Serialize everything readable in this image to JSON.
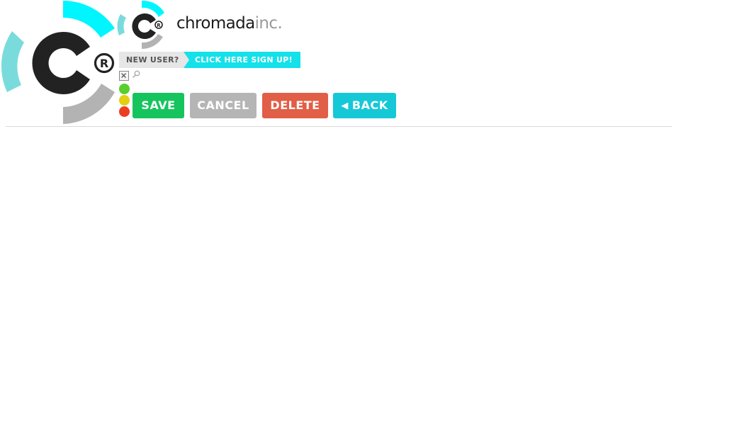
{
  "brand": {
    "logo_letter": "C",
    "registered_mark": "®",
    "wordmark_primary": "chromada",
    "wordmark_secondary": "inc.",
    "colors": {
      "cyan": "#00f6ff",
      "teal_light": "#7adbdd",
      "gray": "#b3b3b3",
      "dark": "#222222"
    }
  },
  "signup": {
    "prompt": "NEW USER?",
    "link": "CLICK HERE SIGN UP!",
    "colors": {
      "prompt_bg": "#e6e6e6",
      "link_bg": "#14e1ea"
    }
  },
  "icons": {
    "close": "close-icon",
    "search": "search-icon"
  },
  "status_dots": [
    {
      "name": "green",
      "color": "#58cf2c"
    },
    {
      "name": "yellow",
      "color": "#e4cf10"
    },
    {
      "name": "red",
      "color": "#ec3f22"
    }
  ],
  "buttons": {
    "save": {
      "label": "SAVE",
      "color": "#16c45e"
    },
    "cancel": {
      "label": "CANCEL",
      "color": "#b5b5b5"
    },
    "delete": {
      "label": "DELETE",
      "color": "#e05f46"
    },
    "back": {
      "label": "BACK",
      "icon": "chevron-left-icon",
      "color": "#15c8d6"
    }
  }
}
